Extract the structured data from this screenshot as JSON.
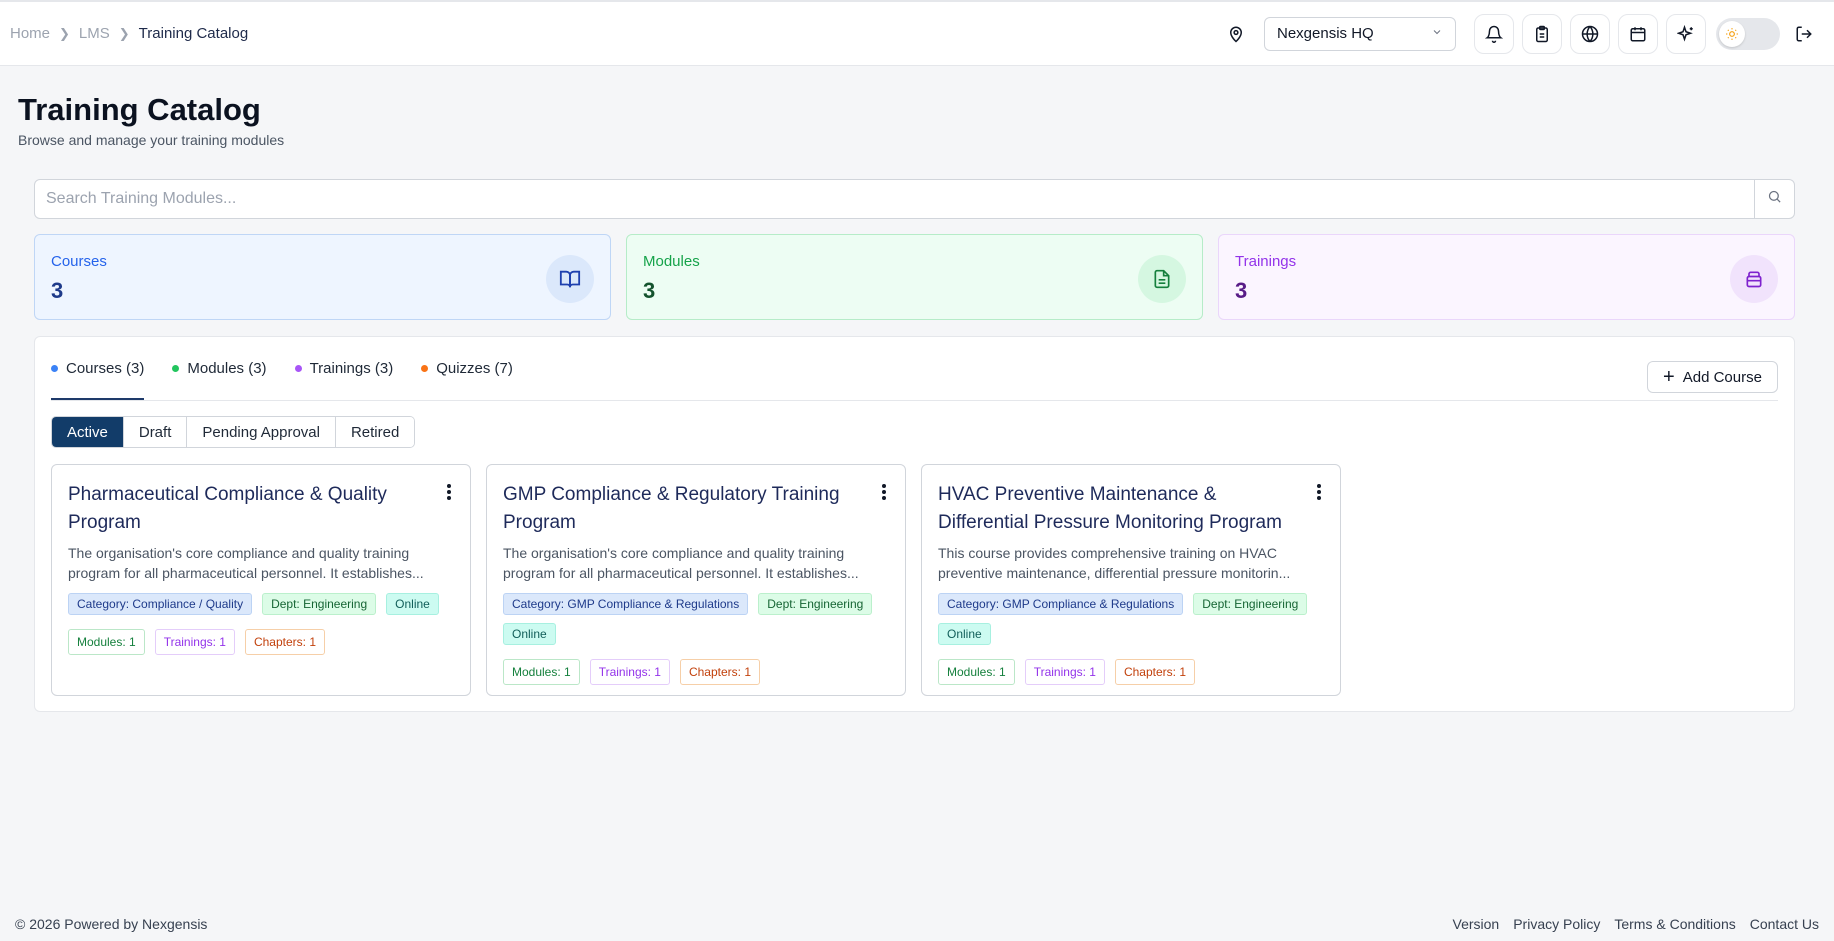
{
  "breadcrumb": {
    "home": "Home",
    "lms": "LMS",
    "current": "Training Catalog"
  },
  "header": {
    "location": "Nexgensis HQ"
  },
  "page": {
    "title": "Training Catalog",
    "subtitle": "Browse and manage your training modules"
  },
  "search": {
    "placeholder": "Search Training Modules..."
  },
  "stats": [
    {
      "label": "Courses",
      "value": "3",
      "icon": "book-open-icon",
      "color": "#2563eb"
    },
    {
      "label": "Modules",
      "value": "3",
      "icon": "file-text-icon",
      "color": "#16a34a"
    },
    {
      "label": "Trainings",
      "value": "3",
      "icon": "archive-icon",
      "color": "#9333ea"
    }
  ],
  "tabs": [
    {
      "label": "Courses (3)",
      "color": "#3b82f6",
      "active": true
    },
    {
      "label": "Modules (3)",
      "color": "#22c55e"
    },
    {
      "label": "Trainings (3)",
      "color": "#a855f7"
    },
    {
      "label": "Quizzes (7)",
      "color": "#f97316"
    }
  ],
  "add_button": {
    "label": "Add Course"
  },
  "filters": [
    "Active",
    "Draft",
    "Pending Approval",
    "Retired"
  ],
  "courses": [
    {
      "title": "Pharmaceutical Compliance & Quality Program",
      "description": "The organisation's core compliance and quality training program for all pharmaceutical personnel. It establishes...",
      "category": "Category: Compliance / Quality",
      "dept": "Dept: Engineering",
      "mode": "Online",
      "modules": "Modules: 1",
      "trainings": "Trainings: 1",
      "chapters": "Chapters: 1"
    },
    {
      "title": "GMP Compliance & Regulatory Training Program",
      "description": "The organisation's core compliance and quality training program for all pharmaceutical personnel. It establishes...",
      "category": "Category: GMP Compliance & Regulations",
      "dept": "Dept: Engineering",
      "mode": "Online",
      "modules": "Modules: 1",
      "trainings": "Trainings: 1",
      "chapters": "Chapters: 1"
    },
    {
      "title": "HVAC Preventive Maintenance & Differential Pressure Monitoring Program",
      "description": "This course provides comprehensive training on HVAC preventive maintenance, differential pressure monitorin...",
      "category": "Category: GMP Compliance & Regulations",
      "dept": "Dept: Engineering",
      "mode": "Online",
      "modules": "Modules: 1",
      "trainings": "Trainings: 1",
      "chapters": "Chapters: 1"
    }
  ],
  "footer": {
    "copyright": "© 2026 Powered by Nexgensis",
    "links": [
      "Version",
      "Privacy Policy",
      "Terms & Conditions",
      "Contact Us"
    ]
  }
}
